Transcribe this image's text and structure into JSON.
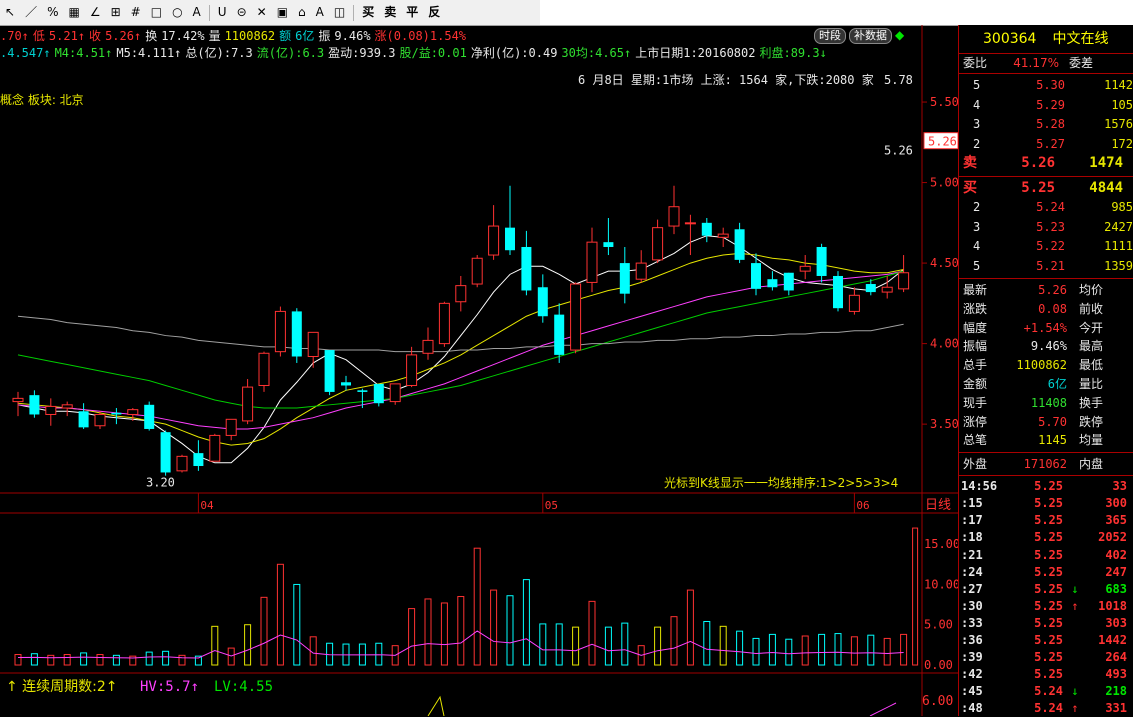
{
  "toolbar": {
    "tools": [
      "↖",
      "／",
      "%",
      "▦",
      "∠",
      "⊞",
      "#",
      "□",
      "○",
      "A",
      "U",
      "⊝",
      "✕",
      "▣",
      "⌂",
      "A",
      "◫",
      "买",
      "卖",
      "平",
      "反"
    ]
  },
  "info1": {
    "items": [
      {
        "t": ".70↑",
        "c": "red"
      },
      {
        "t": "低",
        "c": "red"
      },
      {
        "t": "5.21↑",
        "c": "red"
      },
      {
        "t": "收",
        "c": "red"
      },
      {
        "t": "5.26↑",
        "c": "red"
      },
      {
        "t": "换",
        "c": "white"
      },
      {
        "t": "17.42%",
        "c": "white"
      },
      {
        "t": "量",
        "c": "white"
      },
      {
        "t": "1100862",
        "c": "yellow"
      },
      {
        "t": "额",
        "c": "cyan"
      },
      {
        "t": "6亿",
        "c": "cyan"
      },
      {
        "t": "振",
        "c": "white"
      },
      {
        "t": "9.46%",
        "c": "white"
      },
      {
        "t": "涨(0.08)1.54%",
        "c": "red"
      }
    ]
  },
  "info2": {
    "items": [
      {
        "t": ".4.547↑",
        "c": "cyan"
      },
      {
        "t": "M4:4.51↑",
        "c": "grn"
      },
      {
        "t": "M5:4.111↑",
        "c": "white"
      },
      {
        "t": "总(亿):7.3",
        "c": "white"
      },
      {
        "t": "流(亿):6.3",
        "c": "grn"
      },
      {
        "t": "盈动:939.3",
        "c": "white"
      },
      {
        "t": "股/益:0.01",
        "c": "grn"
      },
      {
        "t": "净利(亿):0.49",
        "c": "white"
      },
      {
        "t": "30均:4.65↑",
        "c": "grn"
      },
      {
        "t": "上市日期1:20160802",
        "c": "white"
      },
      {
        "t": "利盘:89.3↓",
        "c": "grn"
      }
    ]
  },
  "period_buttons": [
    "时段",
    "补数据"
  ],
  "market_line": "6 月8日  星期:1市场 上涨: 1564 家,下跌:2080 家",
  "concept_line": "概念 板块: 北京",
  "hint": "光标到K线显示一一均线排序:1>2>5>3>4",
  "day_label": "日线",
  "indicator": {
    "prefix": "↑ 连续周期数:2↑",
    "hv": "HV:5.7↑",
    "lv": "LV:4.55"
  },
  "colors": {
    "up": "#ff3232",
    "down": "#00ffff",
    "ma1": "#ffffff",
    "ma2": "#e6e600",
    "ma3": "#ff40ff",
    "ma4": "#00cc00",
    "ma5": "#a0a0a0",
    "grid": "#a00000"
  },
  "right_panel": {
    "code": "300364",
    "name": "中文在线",
    "weibi_label": "委比",
    "weibi_value": "41.17%",
    "weicha_label": "委差",
    "sell": [
      {
        "lv": "5",
        "price": "5.30",
        "vol": "1142"
      },
      {
        "lv": "4",
        "price": "5.29",
        "vol": "105"
      },
      {
        "lv": "3",
        "price": "5.28",
        "vol": "1576"
      },
      {
        "lv": "2",
        "price": "5.27",
        "vol": "172"
      },
      {
        "lv": "卖",
        "price": "5.26",
        "vol": "1474"
      }
    ],
    "buy": [
      {
        "lv": "买",
        "price": "5.25",
        "vol": "4844"
      },
      {
        "lv": "2",
        "price": "5.24",
        "vol": "985"
      },
      {
        "lv": "3",
        "price": "5.23",
        "vol": "2427"
      },
      {
        "lv": "4",
        "price": "5.22",
        "vol": "1111"
      },
      {
        "lv": "5",
        "price": "5.21",
        "vol": "1359"
      }
    ],
    "quotes": [
      {
        "l": "最新",
        "v": "5.26",
        "c": "red",
        "r": "均价"
      },
      {
        "l": "涨跌",
        "v": "0.08",
        "c": "red",
        "r": "前收"
      },
      {
        "l": "幅度",
        "v": "+1.54%",
        "c": "red",
        "r": "今开"
      },
      {
        "l": "振幅",
        "v": "9.46%",
        "c": "white",
        "r": "最高"
      },
      {
        "l": "总手",
        "v": "1100862",
        "c": "yellow",
        "r": "最低"
      },
      {
        "l": "金额",
        "v": "6亿",
        "c": "cyan",
        "r": "量比"
      },
      {
        "l": "现手",
        "v": "11408",
        "c": "grn",
        "r": "换手"
      },
      {
        "l": "涨停",
        "v": "5.70",
        "c": "red",
        "r": "跌停"
      },
      {
        "l": "总笔",
        "v": "1145",
        "c": "yellow",
        "r": "均量"
      }
    ],
    "outer_label": "外盘",
    "outer_value": "171062",
    "inner_label": "内盘",
    "ticks": [
      {
        "t": "14:56",
        "p": "5.25",
        "a": "",
        "ac": "white",
        "v": "33",
        "vc": "red"
      },
      {
        "t": ":15",
        "p": "5.25",
        "a": "",
        "ac": "white",
        "v": "300",
        "vc": "red"
      },
      {
        "t": ":17",
        "p": "5.25",
        "a": "",
        "ac": "white",
        "v": "365",
        "vc": "red"
      },
      {
        "t": ":18",
        "p": "5.25",
        "a": "",
        "ac": "white",
        "v": "2052",
        "vc": "red"
      },
      {
        "t": ":21",
        "p": "5.25",
        "a": "",
        "ac": "white",
        "v": "402",
        "vc": "red"
      },
      {
        "t": ":24",
        "p": "5.25",
        "a": "",
        "ac": "white",
        "v": "247",
        "vc": "red"
      },
      {
        "t": ":27",
        "p": "5.25",
        "a": "↓",
        "ac": "green",
        "v": "683",
        "vc": "green"
      },
      {
        "t": ":30",
        "p": "5.25",
        "a": "↑",
        "ac": "red",
        "v": "1018",
        "vc": "red"
      },
      {
        "t": ":33",
        "p": "5.25",
        "a": "",
        "ac": "white",
        "v": "303",
        "vc": "red"
      },
      {
        "t": ":36",
        "p": "5.25",
        "a": "",
        "ac": "white",
        "v": "1442",
        "vc": "red"
      },
      {
        "t": ":39",
        "p": "5.25",
        "a": "",
        "ac": "white",
        "v": "264",
        "vc": "red"
      },
      {
        "t": ":42",
        "p": "5.25",
        "a": "",
        "ac": "white",
        "v": "493",
        "vc": "red"
      },
      {
        "t": ":45",
        "p": "5.24",
        "a": "↓",
        "ac": "green",
        "v": "218",
        "vc": "green"
      },
      {
        "t": ":48",
        "p": "5.24",
        "a": "↑",
        "ac": "red",
        "v": "331",
        "vc": "red"
      }
    ]
  },
  "chart_data": {
    "type": "candlestick",
    "price_axis": {
      "ticks": [
        "5.50",
        "5.00",
        "4.50",
        "4.00",
        "3.50"
      ],
      "values": [
        5.5,
        5.0,
        4.5,
        4.0,
        3.5
      ],
      "ylim": [
        3.06,
        5.73
      ]
    },
    "volume_axis": {
      "ticks": [
        "15.00",
        "10.00",
        "5.00",
        "0.00"
      ],
      "values": [
        15,
        10,
        5,
        0
      ],
      "unit": "万",
      "ylim": [
        0,
        18
      ]
    },
    "indicator_axis": {
      "ticks": [
        "6.00"
      ]
    },
    "month_labels": [
      {
        "label": "04",
        "index": 11
      },
      {
        "label": "05",
        "index": 32
      },
      {
        "label": "06",
        "index": 51
      }
    ],
    "annotations": [
      {
        "label": "3.20",
        "index": 10,
        "value": 3.2
      },
      {
        "label": "5.26",
        "index": 55,
        "value": 5.26
      },
      {
        "label": "5.78",
        "index": 55,
        "value": 5.7
      }
    ],
    "candles": [
      {
        "o": 3.64,
        "h": 3.7,
        "c": 3.66,
        "l": 3.55,
        "v": 1.3
      },
      {
        "o": 3.68,
        "h": 3.71,
        "c": 3.56,
        "l": 3.54,
        "v": 1.4
      },
      {
        "o": 3.56,
        "h": 3.66,
        "c": 3.61,
        "l": 3.49,
        "v": 1.2
      },
      {
        "o": 3.6,
        "h": 3.64,
        "c": 3.62,
        "l": 3.55,
        "v": 1.3
      },
      {
        "o": 3.58,
        "h": 3.63,
        "c": 3.48,
        "l": 3.47,
        "v": 1.5
      },
      {
        "o": 3.49,
        "h": 3.58,
        "c": 3.56,
        "l": 3.47,
        "v": 1.3
      },
      {
        "o": 3.57,
        "h": 3.6,
        "c": 3.56,
        "l": 3.5,
        "v": 1.2
      },
      {
        "o": 3.56,
        "h": 3.6,
        "c": 3.59,
        "l": 3.52,
        "v": 1.1
      },
      {
        "o": 3.62,
        "h": 3.64,
        "c": 3.47,
        "l": 3.46,
        "v": 1.6
      },
      {
        "o": 3.45,
        "h": 3.46,
        "c": 3.2,
        "l": 3.18,
        "v": 1.7
      },
      {
        "o": 3.21,
        "h": 3.31,
        "c": 3.3,
        "l": 3.2,
        "v": 1.2
      },
      {
        "o": 3.32,
        "h": 3.4,
        "c": 3.24,
        "l": 3.21,
        "v": 1.1
      },
      {
        "o": 3.27,
        "h": 3.44,
        "c": 3.43,
        "l": 3.27,
        "v": 4.8
      },
      {
        "o": 3.43,
        "h": 3.52,
        "c": 3.53,
        "l": 3.4,
        "v": 2.1
      },
      {
        "o": 3.52,
        "h": 3.78,
        "c": 3.73,
        "l": 3.5,
        "v": 5.0
      },
      {
        "o": 3.74,
        "h": 3.95,
        "c": 3.94,
        "l": 3.7,
        "v": 8.4
      },
      {
        "o": 3.95,
        "h": 4.23,
        "c": 4.2,
        "l": 3.92,
        "v": 12.5
      },
      {
        "o": 4.2,
        "h": 4.22,
        "c": 3.92,
        "l": 3.88,
        "v": 10.0
      },
      {
        "o": 3.92,
        "h": 4.06,
        "c": 4.07,
        "l": 3.85,
        "v": 3.5
      },
      {
        "o": 3.96,
        "h": 3.9,
        "c": 3.7,
        "l": 3.68,
        "v": 2.7
      },
      {
        "o": 3.76,
        "h": 3.8,
        "c": 3.74,
        "l": 3.71,
        "v": 2.6
      },
      {
        "o": 3.71,
        "h": 3.72,
        "c": 3.7,
        "l": 3.6,
        "v": 2.6
      },
      {
        "o": 3.75,
        "h": 3.75,
        "c": 3.63,
        "l": 3.61,
        "v": 2.7
      },
      {
        "o": 3.64,
        "h": 3.73,
        "c": 3.75,
        "l": 3.62,
        "v": 2.4
      },
      {
        "o": 3.74,
        "h": 3.98,
        "c": 3.93,
        "l": 3.73,
        "v": 7.0
      },
      {
        "o": 3.94,
        "h": 4.1,
        "c": 4.02,
        "l": 3.9,
        "v": 8.2
      },
      {
        "o": 4.0,
        "h": 4.26,
        "c": 4.25,
        "l": 3.98,
        "v": 7.7
      },
      {
        "o": 4.26,
        "h": 4.42,
        "c": 4.36,
        "l": 4.2,
        "v": 8.5
      },
      {
        "o": 4.37,
        "h": 4.55,
        "c": 4.53,
        "l": 4.35,
        "v": 14.5
      },
      {
        "o": 4.55,
        "h": 4.86,
        "c": 4.73,
        "l": 4.52,
        "v": 9.3
      },
      {
        "o": 4.72,
        "h": 4.98,
        "c": 4.58,
        "l": 4.55,
        "v": 8.6
      },
      {
        "o": 4.6,
        "h": 4.7,
        "c": 4.33,
        "l": 4.3,
        "v": 10.6
      },
      {
        "o": 4.35,
        "h": 4.43,
        "c": 4.17,
        "l": 4.13,
        "v": 5.1
      },
      {
        "o": 4.18,
        "h": 4.25,
        "c": 3.93,
        "l": 3.88,
        "v": 5.1
      },
      {
        "o": 3.96,
        "h": 4.38,
        "c": 4.37,
        "l": 3.94,
        "v": 4.7
      },
      {
        "o": 4.38,
        "h": 4.72,
        "c": 4.63,
        "l": 4.32,
        "v": 7.9
      },
      {
        "o": 4.63,
        "h": 4.78,
        "c": 4.6,
        "l": 4.55,
        "v": 4.7
      },
      {
        "o": 4.5,
        "h": 4.6,
        "c": 4.31,
        "l": 4.25,
        "v": 5.2
      },
      {
        "o": 4.4,
        "h": 4.58,
        "c": 4.5,
        "l": 4.38,
        "v": 2.4
      },
      {
        "o": 4.52,
        "h": 4.77,
        "c": 4.72,
        "l": 4.5,
        "v": 4.7
      },
      {
        "o": 4.73,
        "h": 4.98,
        "c": 4.85,
        "l": 4.68,
        "v": 6.0
      },
      {
        "o": 4.75,
        "h": 4.8,
        "c": 4.75,
        "l": 4.55,
        "v": 9.3
      },
      {
        "o": 4.75,
        "h": 4.78,
        "c": 4.67,
        "l": 4.63,
        "v": 5.4
      },
      {
        "o": 4.66,
        "h": 4.72,
        "c": 4.68,
        "l": 4.6,
        "v": 4.8
      },
      {
        "o": 4.71,
        "h": 4.75,
        "c": 4.52,
        "l": 4.5,
        "v": 4.2
      },
      {
        "o": 4.5,
        "h": 4.56,
        "c": 4.34,
        "l": 4.3,
        "v": 3.3
      },
      {
        "o": 4.4,
        "h": 4.45,
        "c": 4.35,
        "l": 4.33,
        "v": 3.8
      },
      {
        "o": 4.44,
        "h": 4.44,
        "c": 4.33,
        "l": 4.3,
        "v": 3.2
      },
      {
        "o": 4.45,
        "h": 4.55,
        "c": 4.48,
        "l": 4.4,
        "v": 3.6
      },
      {
        "o": 4.6,
        "h": 4.62,
        "c": 4.42,
        "l": 4.38,
        "v": 3.8
      },
      {
        "o": 4.42,
        "h": 4.45,
        "c": 4.22,
        "l": 4.2,
        "v": 3.9
      },
      {
        "o": 4.2,
        "h": 4.35,
        "c": 4.3,
        "l": 4.18,
        "v": 3.5
      },
      {
        "o": 4.37,
        "h": 4.4,
        "c": 4.32,
        "l": 4.3,
        "v": 3.7
      },
      {
        "o": 4.32,
        "h": 4.42,
        "c": 4.35,
        "l": 4.28,
        "v": 3.3
      },
      {
        "o": 4.34,
        "h": 4.55,
        "c": 4.44,
        "l": 4.32,
        "v": 3.8
      }
    ],
    "ma_series": [
      {
        "values": [
          3.62,
          3.6,
          3.58,
          3.58,
          3.57,
          3.55,
          3.54,
          3.53,
          3.52,
          3.45,
          3.38,
          3.3,
          3.26,
          3.26,
          3.35,
          3.48,
          3.65,
          3.76,
          3.88,
          3.94,
          3.9,
          3.82,
          3.74,
          3.71,
          3.75,
          3.82,
          3.92,
          4.05,
          4.18,
          4.32,
          4.43,
          4.48,
          4.48,
          4.43,
          4.37,
          4.41,
          4.45,
          4.45,
          4.46,
          4.51,
          4.56,
          4.63,
          4.67,
          4.66,
          4.6,
          4.53,
          4.46,
          4.41,
          4.38,
          4.37,
          4.36,
          4.34,
          4.33,
          4.38,
          4.46
        ]
      },
      {
        "values": [
          3.63,
          3.62,
          3.61,
          3.6,
          3.59,
          3.57,
          3.55,
          3.54,
          3.52,
          3.5,
          3.46,
          3.42,
          3.39,
          3.37,
          3.38,
          3.41,
          3.47,
          3.54,
          3.6,
          3.66,
          3.71,
          3.73,
          3.75,
          3.77,
          3.8,
          3.84,
          3.88,
          3.93,
          3.99,
          4.05,
          4.11,
          4.17,
          4.21,
          4.24,
          4.27,
          4.3,
          4.33,
          4.35,
          4.38,
          4.42,
          4.46,
          4.5,
          4.53,
          4.55,
          4.56,
          4.55,
          4.53,
          4.52,
          4.5,
          4.49,
          4.47,
          4.45,
          4.44,
          4.44,
          4.46
        ]
      },
      {
        "values": [
          3.62,
          3.61,
          3.6,
          3.6,
          3.59,
          3.58,
          3.57,
          3.56,
          3.55,
          3.53,
          3.51,
          3.49,
          3.48,
          3.47,
          3.47,
          3.48,
          3.5,
          3.52,
          3.54,
          3.57,
          3.6,
          3.62,
          3.64,
          3.66,
          3.69,
          3.72,
          3.75,
          3.79,
          3.83,
          3.87,
          3.91,
          3.95,
          3.99,
          4.02,
          4.05,
          4.08,
          4.11,
          4.14,
          4.17,
          4.2,
          4.23,
          4.26,
          4.29,
          4.31,
          4.33,
          4.35,
          4.36,
          4.37,
          4.38,
          4.39,
          4.4,
          4.41,
          4.42,
          4.43,
          4.45
        ]
      },
      {
        "values": [
          3.93,
          3.91,
          3.89,
          3.87,
          3.85,
          3.83,
          3.81,
          3.79,
          3.77,
          3.74,
          3.71,
          3.68,
          3.65,
          3.63,
          3.61,
          3.6,
          3.6,
          3.6,
          3.61,
          3.62,
          3.63,
          3.64,
          3.65,
          3.66,
          3.68,
          3.7,
          3.72,
          3.74,
          3.77,
          3.8,
          3.83,
          3.86,
          3.89,
          3.92,
          3.95,
          3.98,
          4.01,
          4.04,
          4.07,
          4.1,
          4.13,
          4.16,
          4.19,
          4.21,
          4.23,
          4.25,
          4.27,
          4.29,
          4.31,
          4.33,
          4.35,
          4.37,
          4.39,
          4.42,
          4.45
        ]
      },
      {
        "values": [
          4.17,
          4.16,
          4.15,
          4.13,
          4.12,
          4.11,
          4.1,
          4.08,
          4.07,
          4.05,
          4.04,
          4.02,
          4.01,
          4.0,
          3.99,
          3.98,
          3.98,
          3.97,
          3.97,
          3.96,
          3.96,
          3.96,
          3.96,
          3.95,
          3.95,
          3.95,
          3.95,
          3.96,
          3.96,
          3.97,
          3.97,
          3.98,
          3.98,
          3.99,
          3.99,
          4.0,
          4.0,
          4.01,
          4.01,
          4.02,
          4.02,
          4.03,
          4.03,
          4.04,
          4.04,
          4.05,
          4.05,
          4.06,
          4.06,
          4.07,
          4.07,
          4.08,
          4.08,
          4.1,
          4.12
        ]
      }
    ]
  }
}
